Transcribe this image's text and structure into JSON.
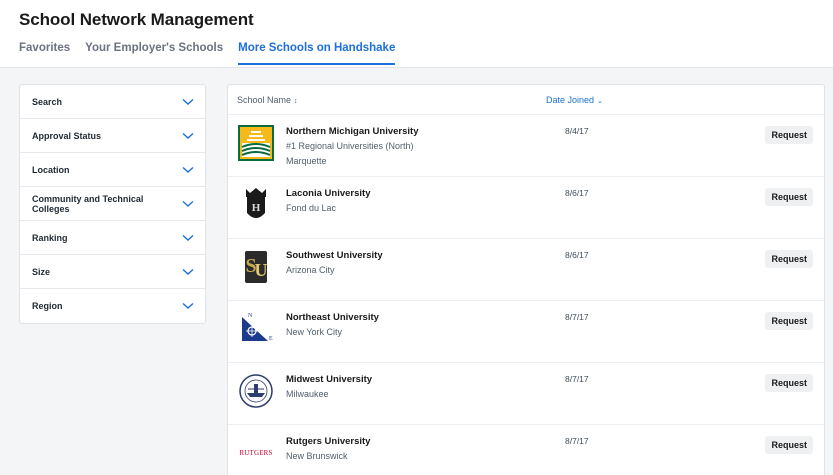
{
  "header": {
    "title": "School Network Management",
    "tabs": [
      {
        "label": "Favorites",
        "active": false
      },
      {
        "label": "Your Employer's Schools",
        "active": false
      },
      {
        "label": "More Schools on Handshake",
        "active": true
      }
    ]
  },
  "filters": [
    {
      "label": "Search",
      "icon": "chevron-down-icon"
    },
    {
      "label": "Approval Status",
      "icon": "chevron-down-icon"
    },
    {
      "label": "Location",
      "icon": "chevron-down-icon"
    },
    {
      "label": "Community and Technical Colleges",
      "icon": "chevron-down-icon"
    },
    {
      "label": "Ranking",
      "icon": "chevron-down-icon"
    },
    {
      "label": "Size",
      "icon": "chevron-down-icon"
    },
    {
      "label": "Region",
      "icon": "chevron-down-icon"
    }
  ],
  "table": {
    "columns": {
      "name": "School Name",
      "date": "Date Joined"
    },
    "rows": [
      {
        "name": "Northern Michigan University",
        "rank": "#1 Regional Universities (North)",
        "location": "Marquette",
        "date": "8/4/17",
        "action": "Request",
        "logo": "nmu-logo"
      },
      {
        "name": "Laconia University",
        "rank": "",
        "location": "Fond du Lac",
        "date": "8/6/17",
        "action": "Request",
        "logo": "laconia-logo"
      },
      {
        "name": "Southwest University",
        "rank": "",
        "location": "Arizona City",
        "date": "8/6/17",
        "action": "Request",
        "logo": "southwest-logo"
      },
      {
        "name": "Northeast University",
        "rank": "",
        "location": "New York City",
        "date": "8/7/17",
        "action": "Request",
        "logo": "northeast-logo"
      },
      {
        "name": "Midwest University",
        "rank": "",
        "location": "Milwaukee",
        "date": "8/7/17",
        "action": "Request",
        "logo": "midwest-logo"
      },
      {
        "name": "Rutgers University",
        "rank": "",
        "location": "New Brunswick",
        "date": "8/7/17",
        "action": "Request",
        "logo": "rutgers-logo",
        "logo_text": "RUTGERS"
      }
    ]
  },
  "colors": {
    "accent": "#1e6fd9",
    "background": "#f4f5f7"
  }
}
